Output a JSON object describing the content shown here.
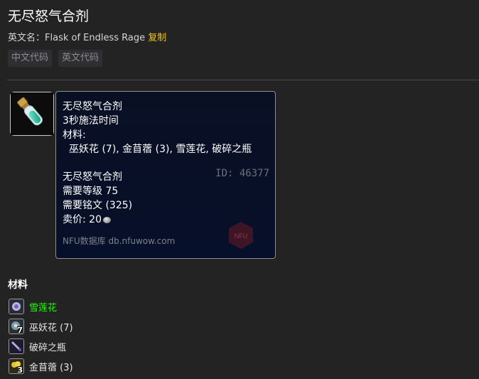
{
  "page": {
    "title": "无尽怒气合剂",
    "en_label": "英文名：",
    "en_name": "Flask of Endless Rage",
    "copy_label": "复制",
    "code_buttons": [
      "中文代码",
      "英文代码"
    ]
  },
  "tooltip": {
    "name": "无尽怒气合剂",
    "cast": "3秒施法时间",
    "materials_label": "材料:",
    "materials_line": "巫妖花 (7), 金苜蓿 (3), 雪莲花, 破碎之瓶",
    "item_name": "无尽怒气合剂",
    "id_text": "ID: 46377",
    "req_level": "需要等级 75",
    "req_skill": "需要铭文 (325)",
    "sell_label": "卖价:",
    "sell_value": "20",
    "site": "NFU数据库 db.nfuwow.com",
    "watermark": "NFU"
  },
  "materials": {
    "heading": "材料",
    "items": [
      {
        "label": "雪莲花",
        "count": "",
        "icon": "snow-lily-icon",
        "color": "#1eff00"
      },
      {
        "label": "巫妖花 (7)",
        "count": "7",
        "icon": "lichbloom-icon",
        "color": "#e6e6e6"
      },
      {
        "label": "破碎之瓶",
        "count": "",
        "icon": "broken-vial-icon",
        "color": "#e6e6e6"
      },
      {
        "label": "金苜蓿 (3)",
        "count": "3",
        "icon": "goldclover-icon",
        "color": "#e6e6e6"
      }
    ]
  },
  "colors": {
    "background": "#232323",
    "copy_link": "#f0c419",
    "uncommon_green": "#1eff00",
    "tooltip_bg": "#0a1024"
  }
}
